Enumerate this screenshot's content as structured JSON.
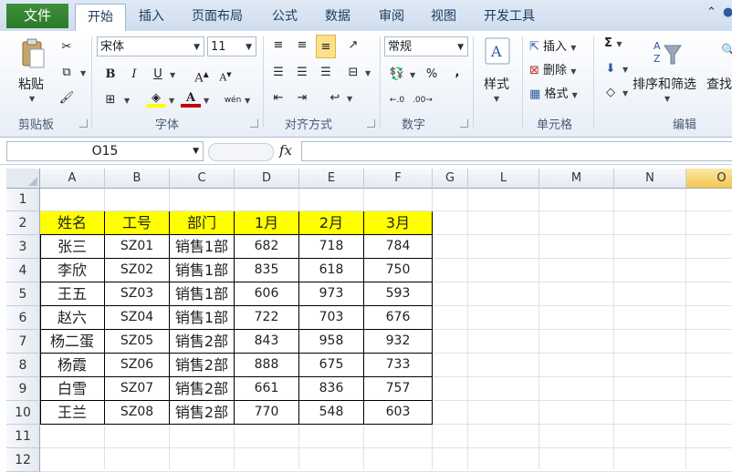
{
  "ribbon_tabs": {
    "file": "文件",
    "home": "开始",
    "insert": "插入",
    "page_layout": "页面布局",
    "formulas": "公式",
    "data": "数据",
    "review": "审阅",
    "view": "视图",
    "developer": "开发工具"
  },
  "clipboard": {
    "paste": "粘贴",
    "label": "剪贴板"
  },
  "font": {
    "name": "宋体",
    "size": "11",
    "bold": "B",
    "italic": "I",
    "underline": "U",
    "grow": "A",
    "shrink": "A",
    "label": "字体"
  },
  "alignment": {
    "label": "对齐方式"
  },
  "number": {
    "format": "常规",
    "percent": "%",
    "comma": ",",
    "label": "数字"
  },
  "styles": {
    "label": "样式"
  },
  "cells": {
    "insert": "插入",
    "delete": "删除",
    "format": "格式",
    "label": "单元格"
  },
  "editing": {
    "sum": "Σ",
    "sort_filter": "排序和筛选",
    "find": "查找",
    "label": "编辑"
  },
  "formula_bar": {
    "name_box": "O15",
    "fx": "fx",
    "formula": ""
  },
  "columns": [
    "A",
    "B",
    "C",
    "D",
    "E",
    "F",
    "G",
    "L",
    "M",
    "N",
    "O"
  ],
  "rows": [
    "1",
    "2",
    "3",
    "4",
    "5",
    "6",
    "7",
    "8",
    "9",
    "10",
    "11",
    "12"
  ],
  "table": {
    "headers": [
      "姓名",
      "工号",
      "部门",
      "1月",
      "2月",
      "3月"
    ],
    "rows": [
      [
        "张三",
        "SZ01",
        "销售1部",
        "682",
        "718",
        "784"
      ],
      [
        "李欣",
        "SZ02",
        "销售1部",
        "835",
        "618",
        "750"
      ],
      [
        "王五",
        "SZ03",
        "销售1部",
        "606",
        "973",
        "593"
      ],
      [
        "赵六",
        "SZ04",
        "销售1部",
        "722",
        "703",
        "676"
      ],
      [
        "杨二蛋",
        "SZ05",
        "销售2部",
        "843",
        "958",
        "932"
      ],
      [
        "杨霞",
        "SZ06",
        "销售2部",
        "888",
        "675",
        "733"
      ],
      [
        "白雪",
        "SZ07",
        "销售2部",
        "661",
        "836",
        "757"
      ],
      [
        "王兰",
        "SZ08",
        "销售2部",
        "770",
        "548",
        "603"
      ]
    ]
  },
  "colors": {
    "header_fill": "#ffff00",
    "file_tab": "#2a7a2a",
    "selected_col": "#f4c652"
  }
}
